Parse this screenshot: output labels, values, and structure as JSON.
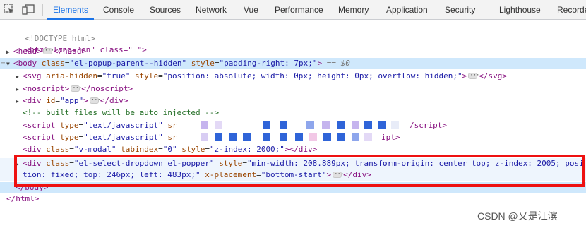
{
  "toolbar": {
    "tabs": [
      "Elements",
      "Console",
      "Sources",
      "Network",
      "Vue",
      "Performance",
      "Memory",
      "Application",
      "Security",
      "Lighthouse",
      "Recorder"
    ],
    "active_tab": "Elements",
    "accent": "#1a73e8"
  },
  "tree": {
    "doctype": "<!DOCTYPE html>",
    "html_open": "<html lang=\"en\" class=\" \">",
    "head": {
      "open": "<head>",
      "close": "</head>"
    },
    "body": {
      "tag": "body",
      "class_attr": "class",
      "class_val": "\"el-popup-parent--hidden\"",
      "style_attr": "style",
      "style_val": "\"padding-right: 7px;\"",
      "eq": "== $0"
    },
    "svg": {
      "open": "<svg",
      "a1": "aria-hidden",
      "v1": "\"true\"",
      "a2": "style",
      "v2": "\"position: absolute; width: 0px; height: 0px; overflow: hidden;\"",
      "close": "</svg>"
    },
    "noscript": {
      "open": "<noscript>",
      "close": "</noscript>"
    },
    "app": {
      "open": "<div",
      "a": "id",
      "v": "\"app\"",
      "close": "</div>"
    },
    "comment": "<!-- built files will be auto injected -->",
    "script1": {
      "open": "<script",
      "a": "type",
      "v": "\"text/javascript\"",
      "src": "sr",
      "close": "/script>"
    },
    "script2": {
      "open": "<script",
      "a": "type",
      "v": "\"text/javascript\"",
      "src": "sr",
      "tail": "ipt>"
    },
    "modal": {
      "open": "<div",
      "a1": "class",
      "v1": "\"v-modal\"",
      "a2": "tabindex",
      "v2": "\"0\"",
      "a3": "style",
      "v3": "\"z-index: 2000;\"",
      "close": "</div>"
    },
    "popper": {
      "open": "<div",
      "a1": "class",
      "v1": "\"el-select-dropdown el-popper\"",
      "a2": "style",
      "v2a": "\"min-width: 208.889px; transform-origin: center top; z-index: 2005; posi",
      "v2b": "tion: fixed; top: 246px; left: 483px;\"",
      "a3": "x-placement",
      "v3": "\"bottom-start\"",
      "close": "</div>"
    },
    "body_close": "</body>",
    "html_close": "</html>"
  },
  "watermark": "CSDN @又是江滨",
  "highlight_color": "#ee1111"
}
